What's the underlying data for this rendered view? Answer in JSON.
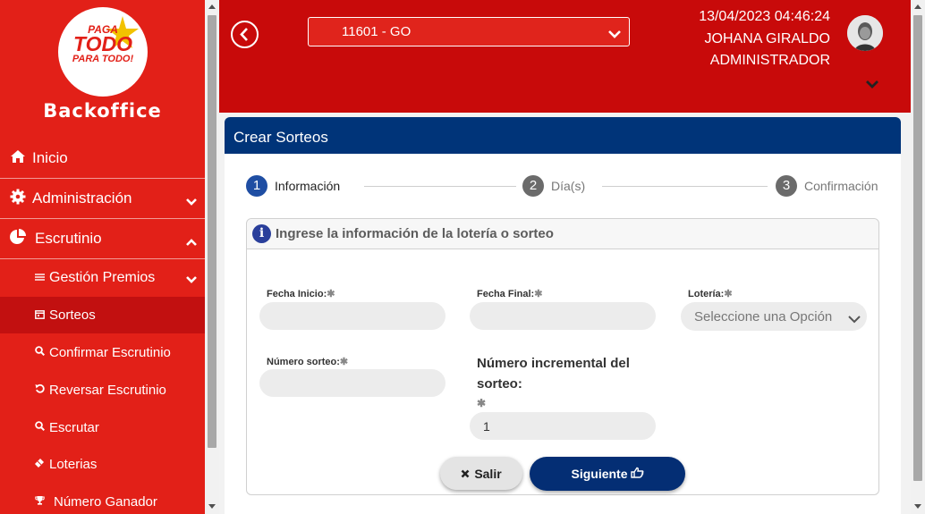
{
  "sidebar": {
    "logo": {
      "line1": "PAGA",
      "line2": "TODO",
      "line3": "PARA TODO!"
    },
    "brand": "Backoffice",
    "items": [
      {
        "label": "Inicio",
        "icon": "home-icon"
      },
      {
        "label": "Administración",
        "icon": "gear-icon",
        "expanded": false
      },
      {
        "label": "Escrutinio",
        "icon": "pie-chart-icon",
        "expanded": true
      }
    ],
    "subitems": [
      {
        "label": "Gestión Premios",
        "icon": "sliders-icon"
      },
      {
        "label": "Sorteos",
        "icon": "calendar-icon",
        "active": true
      },
      {
        "label": "Confirmar Escrutinio",
        "icon": "search-check-icon"
      },
      {
        "label": "Reversar Escrutinio",
        "icon": "undo-icon"
      },
      {
        "label": "Escrutar",
        "icon": "search-icon"
      },
      {
        "label": "Loterias",
        "icon": "ticket-icon"
      },
      {
        "label": "Número Ganador",
        "icon": "trophy-icon"
      }
    ]
  },
  "header": {
    "branch": "11601 - GO",
    "datetime": "13/04/2023 04:46:24",
    "user_name": "JOHANA GIRALDO",
    "role": "ADMINISTRADOR"
  },
  "card": {
    "title": "Crear Sorteos",
    "steps": [
      {
        "number": "1",
        "label": "Información",
        "active": true
      },
      {
        "number": "2",
        "label": "Día(s)",
        "active": false
      },
      {
        "number": "3",
        "label": "Confirmación",
        "active": false
      }
    ],
    "panel_title": "Ingrese la información de la lotería o sorteo",
    "fields": {
      "fecha_inicio": {
        "label": "Fecha Inicio:",
        "value": ""
      },
      "fecha_final": {
        "label": "Fecha Final:",
        "value": ""
      },
      "loteria": {
        "label": "Lotería:",
        "placeholder": "Seleccione una Opción"
      },
      "numero_sorteo": {
        "label": "Número sorteo:",
        "value": ""
      },
      "numero_incremental": {
        "label": "Número incremental del sorteo:",
        "value": "1"
      }
    },
    "required_mark": "✱",
    "buttons": {
      "salir": "Salir",
      "siguiente": "Siguiente"
    }
  },
  "colors": {
    "sidebar_red": "#e22018",
    "header_red": "#c80a0a",
    "navy": "#003479",
    "step_active": "#1f4ea3",
    "step_inactive": "#6b6b6b"
  }
}
